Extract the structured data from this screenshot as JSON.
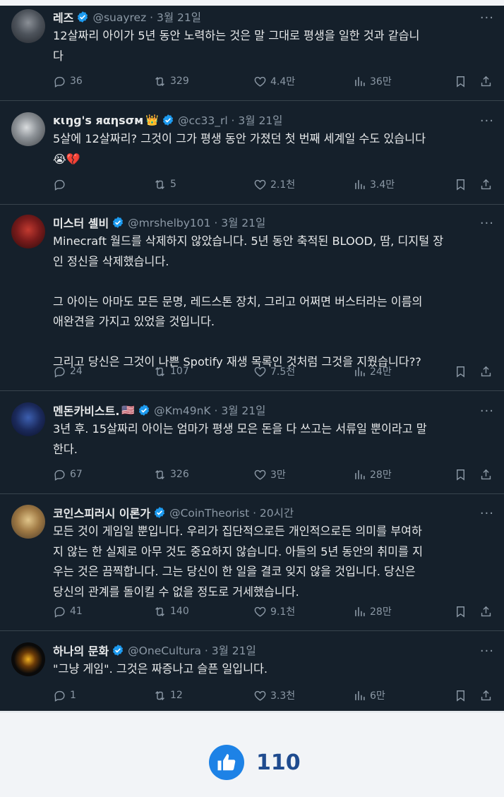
{
  "tweets": [
    {
      "name": "레즈",
      "handle": "@suayrez · 3월 21일",
      "text": "12살짜리 아이가 5년 동안 노력하는 것은 말 그대로 평생을 일한 것과 같습니\n다",
      "replies": "36",
      "retweets": "329",
      "likes": "4.4만",
      "views": "36만"
    },
    {
      "name": "ĸɩŋɡ's яαηsσм",
      "emoji": "👑",
      "handle": "@cc33_rl · 3월 21일",
      "text": "5살에 12살짜리? 그것이 그가 평생 동안 가졌던 첫 번째 세계일 수도 있습니다\n😭💔",
      "replies": "",
      "retweets": "5",
      "likes": "2.1천",
      "views": "3.4만"
    },
    {
      "name": "미스터 셸비",
      "handle": "@mrshelby101 · 3월 21일",
      "text": "Minecraft 월드를 삭제하지 않았습니다. 5년 동안 축적된 BLOOD, 땀, 디지털 장\n인 정신을 삭제했습니다.\n\n그 아이는 아마도 모든 문명, 레드스톤 장치, 그리고 어쩌면 버스터라는 이름의\n애완견을 가지고 있었을 것입니다.\n\n그리고 당신은 그것이 나쁜 Spotify 재생 목록인 것처럼 그것을 지웠습니다??",
      "replies": "24",
      "retweets": "107",
      "likes": "7.5천",
      "views": "24만"
    },
    {
      "name": "멘돈카비스트.",
      "emoji": "🇺🇸",
      "handle": "@Km49nK · 3월 21일",
      "text": "3년 후. 15살짜리 아이는 엄마가 평생 모은 돈을 다 쓰고는 서류일 뿐이라고 말\n한다.",
      "replies": "67",
      "retweets": "326",
      "likes": "3만",
      "views": "28만"
    },
    {
      "name": "코인스피러시 이론가",
      "handle": "@CoinTheorist · 20시간",
      "text": "모든 것이 게임일 뿐입니다. 우리가 집단적으로든 개인적으로든 의미를 부여하\n지 않는 한 실제로 아무 것도 중요하지 않습니다. 아들의 5년 동안의 취미를 지\n우는 것은 끔찍합니다. 그는 당신이 한 일을 결코 잊지 않을 것입니다. 당신은\n당신의 관계를 돌이킬 수 없을 정도로 거세했습니다.",
      "replies": "41",
      "retweets": "140",
      "likes": "9.1천",
      "views": "28만"
    },
    {
      "name": "하나의 문화",
      "handle": "@OneCultura · 3월 21일",
      "text": "\"그냥 게임\". 그것은 짜증나고 슬픈 일입니다.",
      "replies": "1",
      "retweets": "12",
      "likes": "3.3천",
      "views": "6만"
    }
  ],
  "more_label": "···",
  "footer": {
    "like_count": "110"
  },
  "colors": {
    "bg": "#15202b",
    "text": "#e7e9ea",
    "muted": "#8b98a5",
    "verified": "#1d9bf0",
    "like_button": "#1d82e6"
  }
}
